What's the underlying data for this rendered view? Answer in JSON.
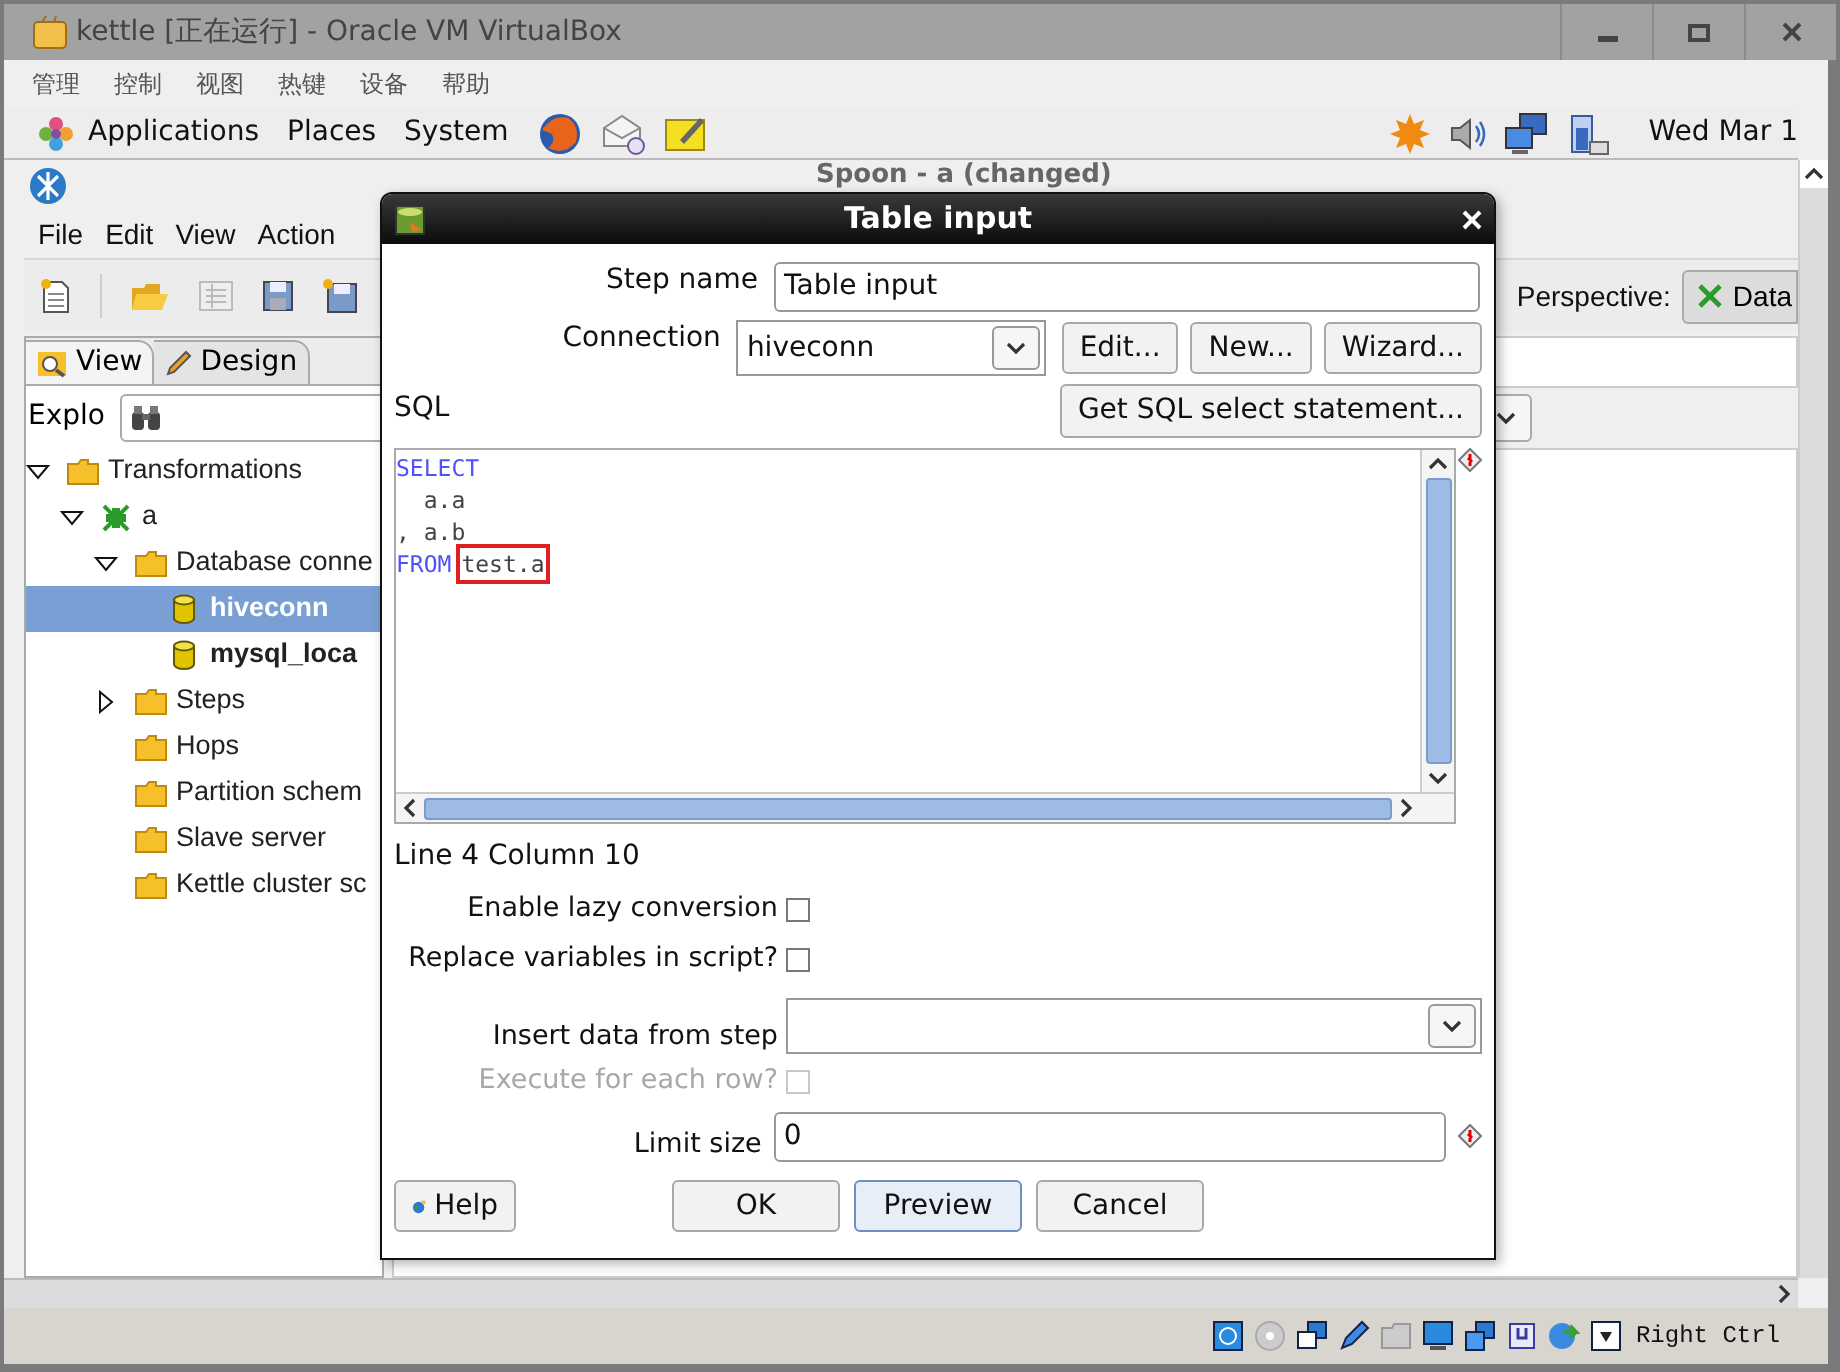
{
  "vbox": {
    "title": "kettle [正在运行] - Oracle VM VirtualBox",
    "menu": [
      "管理",
      "控制",
      "视图",
      "热键",
      "设备",
      "帮助"
    ],
    "host_key": "Right Ctrl"
  },
  "panel": {
    "menus": [
      "Applications",
      "Places",
      "System"
    ],
    "clock": "Wed Mar 1"
  },
  "spoon": {
    "title": "Spoon - a (changed)",
    "menu": [
      "File",
      "Edit",
      "View",
      "Action"
    ],
    "perspective_label": "Perspective:",
    "perspective_button": "Data",
    "tabs": [
      {
        "label": "View",
        "selected": true
      },
      {
        "label": "Design",
        "selected": false
      }
    ],
    "explorer_label": "Explo",
    "tree": [
      {
        "label": "Transformations",
        "kind": "folder",
        "expanded": true,
        "selected": false,
        "children": [
          {
            "label": "a",
            "kind": "transformation",
            "expanded": true,
            "selected": false,
            "children": [
              {
                "label": "Database conne",
                "kind": "folder",
                "expanded": true,
                "selected": false,
                "children": [
                  {
                    "label": "hiveconn",
                    "kind": "connection",
                    "selected": true
                  },
                  {
                    "label": "mysql_loca",
                    "kind": "connection",
                    "selected": false
                  }
                ]
              },
              {
                "label": "Steps",
                "kind": "folder",
                "expanded": false,
                "selected": false
              },
              {
                "label": "Hops",
                "kind": "folder",
                "selected": false
              },
              {
                "label": "Partition schem",
                "kind": "folder",
                "selected": false
              },
              {
                "label": "Slave server",
                "kind": "folder",
                "selected": false
              },
              {
                "label": "Kettle cluster sc",
                "kind": "folder",
                "selected": false
              }
            ]
          }
        ]
      }
    ]
  },
  "dialog": {
    "title": "Table input",
    "step_name": {
      "label": "Step name",
      "value": "Table input"
    },
    "connection": {
      "label": "Connection",
      "value": "hiveconn",
      "buttons": [
        "Edit...",
        "New...",
        "Wizard..."
      ]
    },
    "sql_label": "SQL",
    "get_sql_button": "Get SQL select statement...",
    "sql_lines": [
      {
        "tokens": [
          {
            "text": "SELECT",
            "kind": "keyword"
          }
        ]
      },
      {
        "tokens": [
          {
            "text": "  a.a",
            "kind": "text"
          }
        ]
      },
      {
        "tokens": [
          {
            "text": ", a.b",
            "kind": "text"
          }
        ]
      },
      {
        "tokens": [
          {
            "text": "FROM",
            "kind": "keyword"
          },
          {
            "text": "test.a",
            "kind": "text",
            "highlighted": true
          }
        ]
      }
    ],
    "cursor_position": "Line 4 Column 10",
    "options": [
      {
        "kind": "checkbox",
        "label": "Enable lazy conversion",
        "checked": false,
        "disabled": false
      },
      {
        "kind": "checkbox",
        "label": "Replace variables in script?",
        "checked": false,
        "disabled": false
      },
      {
        "kind": "select",
        "label": "Insert data from step"
      },
      {
        "kind": "checkbox",
        "label": "Execute for each row?",
        "checked": false,
        "disabled": true
      },
      {
        "kind": "input",
        "label": "Limit size",
        "value": "0"
      }
    ],
    "help_button": "Help",
    "buttons": [
      {
        "label": "OK",
        "selected": false
      },
      {
        "label": "Preview",
        "selected": true
      },
      {
        "label": "Cancel",
        "selected": false
      }
    ]
  }
}
